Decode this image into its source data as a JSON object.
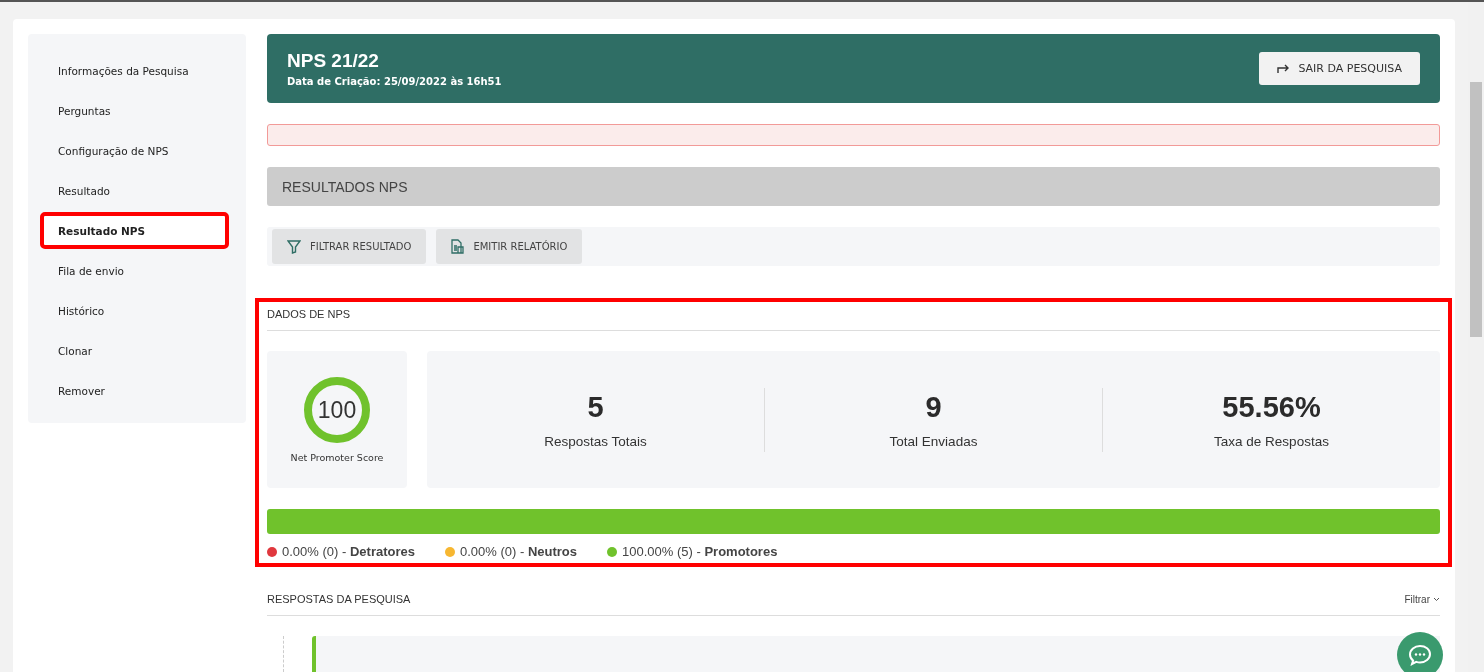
{
  "sidebar": {
    "items": [
      {
        "label": "Informações da Pesquisa",
        "selected": false,
        "highlighted": false
      },
      {
        "label": "Perguntas",
        "selected": false,
        "highlighted": false
      },
      {
        "label": "Configuração de NPS",
        "selected": false,
        "highlighted": false
      },
      {
        "label": "Resultado",
        "selected": false,
        "highlighted": false
      },
      {
        "label": "Resultado NPS",
        "selected": true,
        "highlighted": true
      },
      {
        "label": "Fila de envio",
        "selected": false,
        "highlighted": false
      },
      {
        "label": "Histórico",
        "selected": false,
        "highlighted": false
      },
      {
        "label": "Clonar",
        "selected": false,
        "highlighted": false
      },
      {
        "label": "Remover",
        "selected": false,
        "highlighted": false
      }
    ]
  },
  "header": {
    "title": "NPS 21/22",
    "subtitle": "Data de Criação: 25/09/2022 às 16h51",
    "exit_button": "SAIR DA PESQUISA"
  },
  "results_bar": {
    "title": "RESULTADOS NPS"
  },
  "toolbar": {
    "buttons": [
      {
        "kind": "filter",
        "label": "FILTRAR RESULTADO"
      },
      {
        "kind": "report",
        "label": "EMITIR RELATÓRIO"
      }
    ]
  },
  "nps_data": {
    "title": "DADOS DE NPS",
    "highlighted": true,
    "score": {
      "value": "100",
      "label": "Net Promoter Score"
    },
    "stats": [
      {
        "value": "5",
        "label": "Respostas Totais"
      },
      {
        "value": "9",
        "label": "Total Enviadas"
      },
      {
        "value": "55.56%",
        "label": "Taxa de Respostas"
      }
    ],
    "legend": [
      {
        "reading": "0.00% (0) -",
        "label": "Detratores",
        "color": "#e0383e",
        "level": 0
      },
      {
        "reading": "0.00% (0) -",
        "label": "Neutros",
        "color": "#f7b731",
        "level": 0
      },
      {
        "reading": "100.00% (5) -",
        "label": "Promotores",
        "color": "#70c22c",
        "level": 1
      }
    ]
  },
  "responses": {
    "title": "RESPOSTAS DA PESQUISA",
    "filter": "Filtrar"
  }
}
